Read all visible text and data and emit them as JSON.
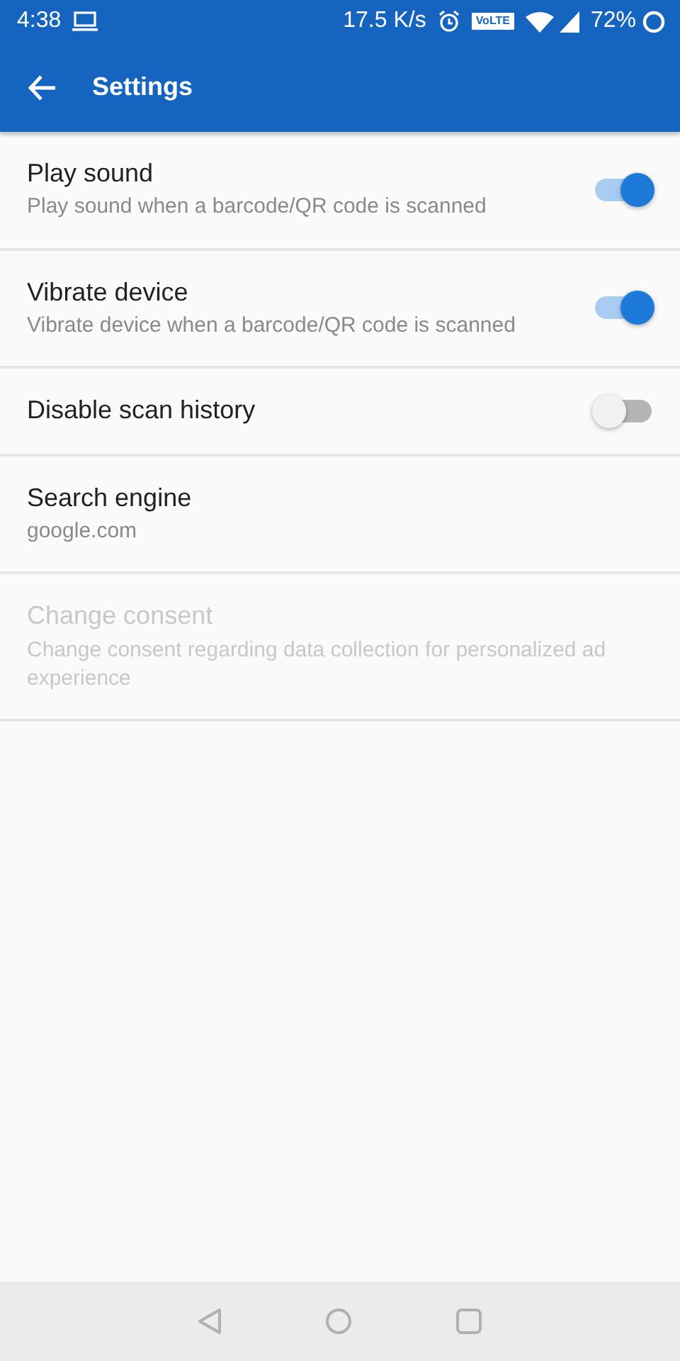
{
  "status_bar": {
    "time": "4:38",
    "speed": "17.5 K/s",
    "volte": "VoLTE",
    "battery": "72%"
  },
  "app_bar": {
    "title": "Settings"
  },
  "settings": [
    {
      "kind": "switch",
      "title": "Play sound",
      "summary": "Play sound when a barcode/QR code is scanned",
      "on": true,
      "disabled": false
    },
    {
      "kind": "switch",
      "title": "Vibrate device",
      "summary": "Vibrate device when a barcode/QR code is scanned",
      "on": true,
      "disabled": false
    },
    {
      "kind": "switch",
      "title": "Disable scan history",
      "on": false,
      "disabled": false
    },
    {
      "kind": "text",
      "title": "Search engine",
      "summary": "google.com",
      "disabled": false
    },
    {
      "kind": "text",
      "title": "Change consent",
      "summary": "Change consent regarding data collection for personalized ad experience",
      "disabled": true
    }
  ]
}
